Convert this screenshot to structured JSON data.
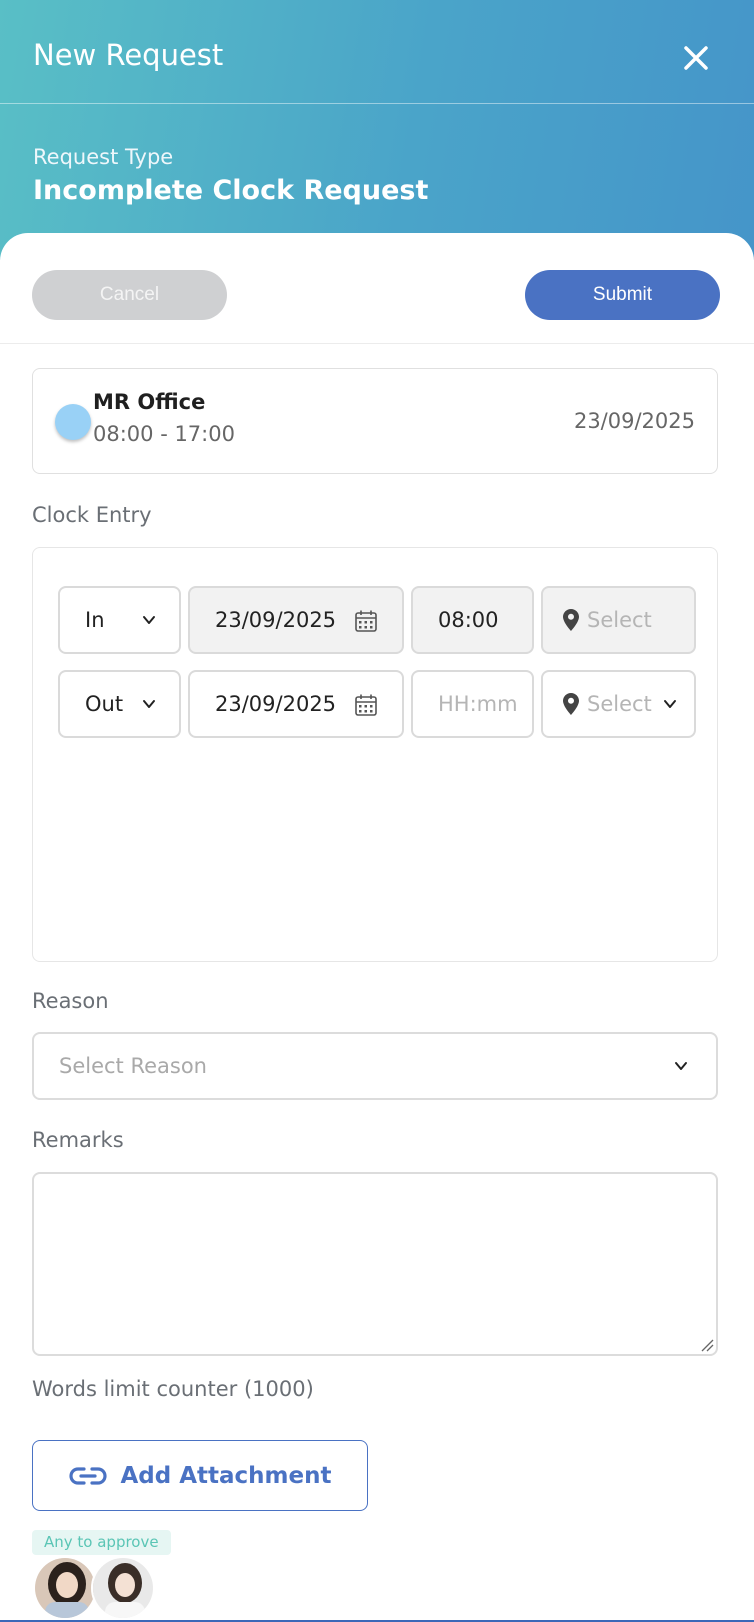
{
  "header": {
    "title": "New Request",
    "request_type_label": "Request Type",
    "request_type_value": "Incomplete Clock Request"
  },
  "actions": {
    "cancel_label": "Cancel",
    "submit_label": "Submit"
  },
  "shift": {
    "name": "MR Office",
    "time": "08:00 - 17:00",
    "date": "23/09/2025"
  },
  "clock_entry": {
    "label": "Clock Entry",
    "rows": [
      {
        "type": "In",
        "date": "23/09/2025",
        "time": "08:00",
        "location_placeholder": "Select"
      },
      {
        "type": "Out",
        "date": "23/09/2025",
        "time_placeholder": "HH:mm",
        "location_placeholder": "Select"
      }
    ]
  },
  "reason": {
    "label": "Reason",
    "placeholder": "Select Reason"
  },
  "remarks": {
    "label": "Remarks",
    "value": "",
    "counter": "Words limit counter (1000)"
  },
  "attachment": {
    "label": "Add Attachment"
  },
  "approval": {
    "badge": "Any to approve",
    "approvers": 2
  },
  "colors": {
    "primary": "#4a72c3",
    "header_start": "#59bfc6",
    "header_end": "#4595c9",
    "accent_teal": "#5ac5b5"
  }
}
